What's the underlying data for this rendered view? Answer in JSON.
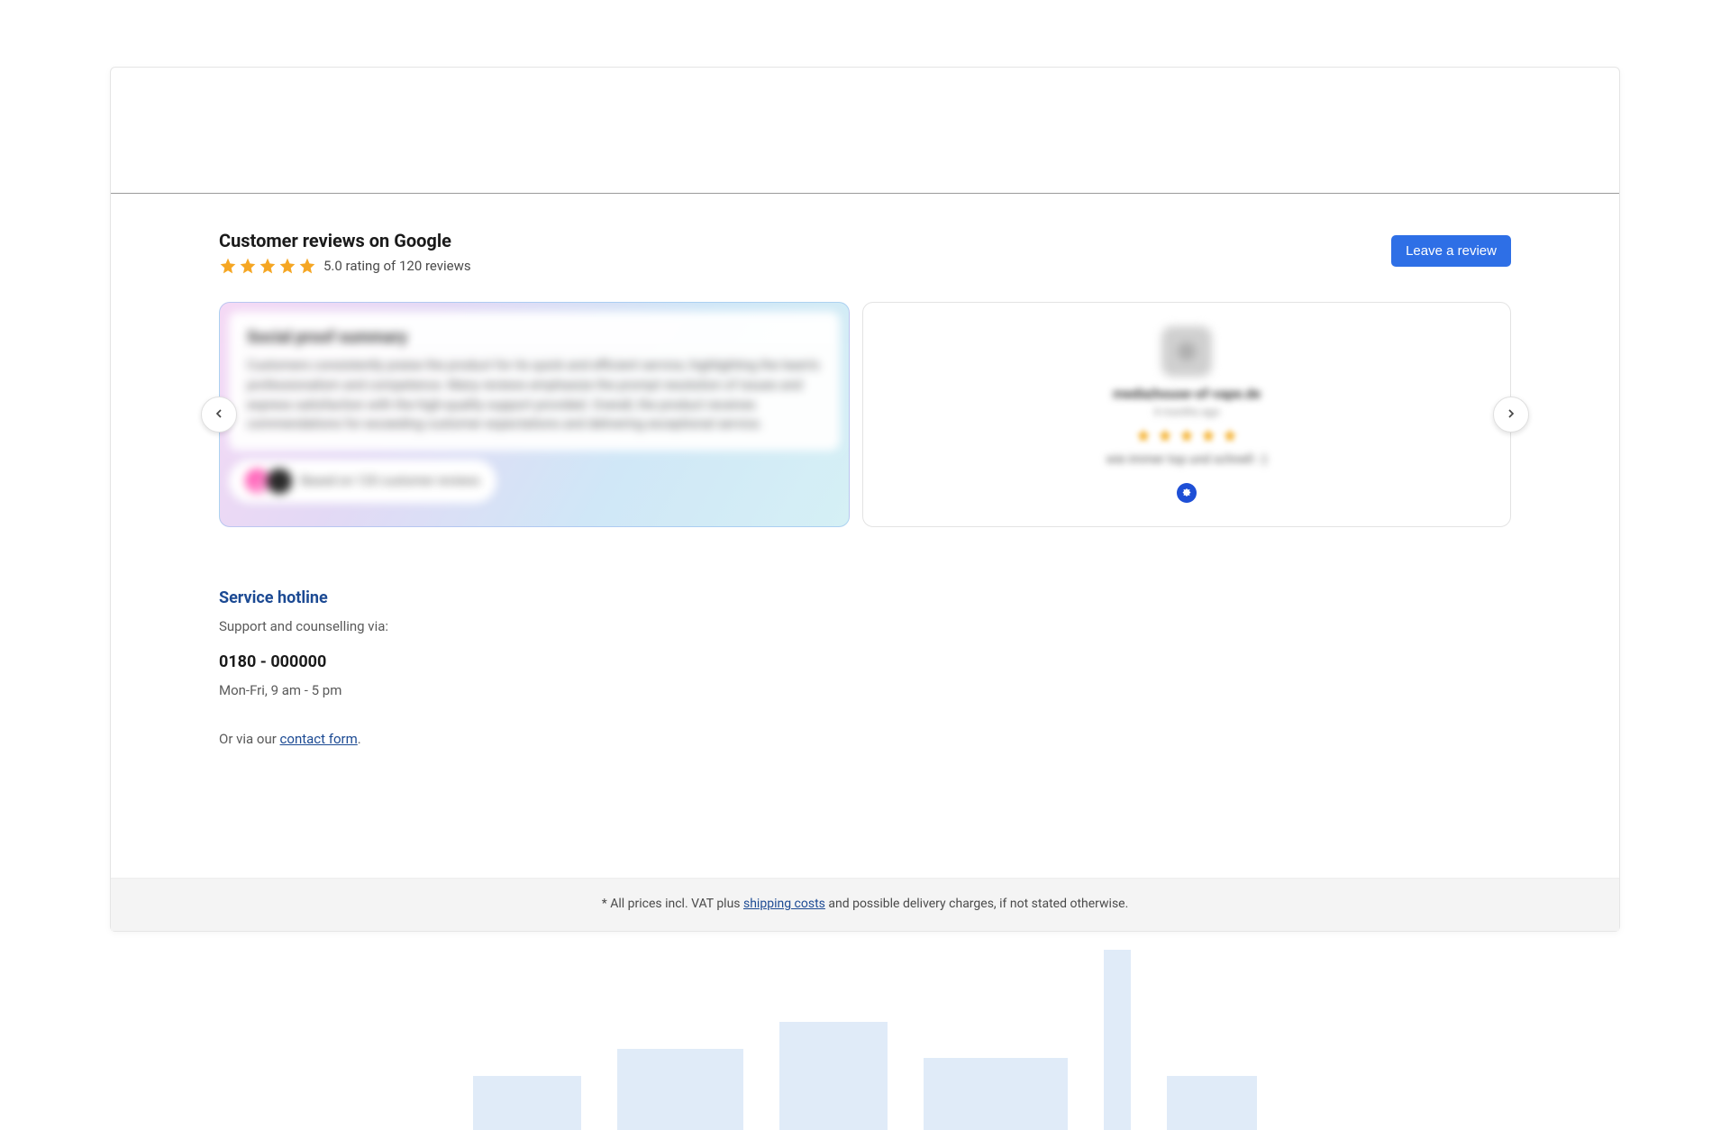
{
  "reviews": {
    "heading": "Customer reviews on Google",
    "rating_text": "5.0 rating of 120 reviews",
    "leave_review_btn": "Leave a review",
    "summary": {
      "title": "Social proof summary",
      "text": "Customers consistently praise the product for its quick and efficient service, highlighting the team's professionalism and competence. Many reviews emphasize the prompt resolution of issues and express satisfaction with the high-quality support provided. Overall, the product receives commendations for exceeding customer expectations and delivering exceptional service.",
      "badge_text": "Based on 120 customer reviews"
    },
    "review_card": {
      "name": "media|house-of-vape.de",
      "time": "4 months ago",
      "text": "wie immer top und schnell :-)"
    }
  },
  "hotline": {
    "title": "Service hotline",
    "subtitle": "Support and counselling via:",
    "number": "0180 - 000000",
    "hours": "Mon-Fri, 9 am - 5 pm",
    "via_prefix": "Or via our ",
    "contact_link": "contact form",
    "via_suffix": "."
  },
  "footer": {
    "prices_prefix": "* All prices incl. VAT plus ",
    "shipping_link": "shipping costs",
    "prices_suffix": " and possible delivery charges, if not stated otherwise."
  }
}
